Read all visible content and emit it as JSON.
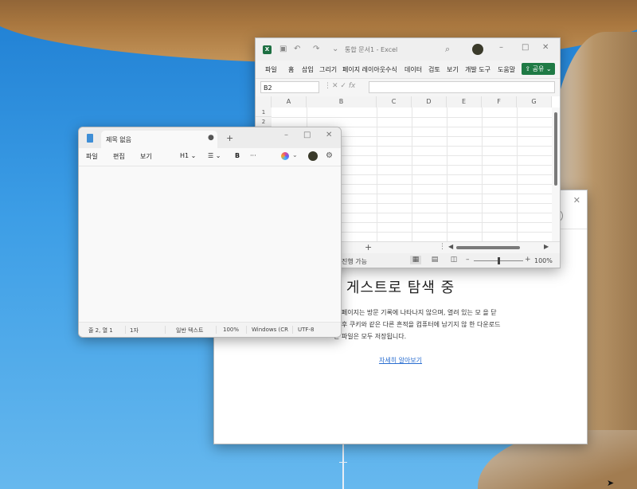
{
  "browser": {
    "title": "게스트로 탐색 중",
    "description": "는 페이지는 방문 기록에 나타나지 않으며, 열려 있는 모 을 닫은 후 쿠키와 같은 다른 흔적을 컴퓨터에 남기지 않 한 다운로드한 파일은 모두 저장됩니다.",
    "link": "자세히 알아보기",
    "close_icon": "close-icon"
  },
  "excel": {
    "doc_title": "통합 문서1 - Excel",
    "logo": "X",
    "tabs": [
      "파일",
      "홈",
      "삽입",
      "그리기",
      "페이지 레이아웃",
      "수식",
      "데이터",
      "검토",
      "보기",
      "개발 도구",
      "도움말"
    ],
    "share_label": "공유",
    "namebox": "B2",
    "fx": "fx",
    "columns": [
      "A",
      "B",
      "C",
      "D",
      "E",
      "F",
      "G"
    ],
    "rows": [
      "1",
      "2"
    ],
    "add_sheet": "+",
    "status_ready": "진행 가능",
    "zoom": "100%"
  },
  "notepad": {
    "tab_title": "제목 없음",
    "dot": "●",
    "new_tab": "+",
    "menus": [
      "파일",
      "편집",
      "보기"
    ],
    "heading": "H1",
    "bold": "B",
    "more": "···",
    "status": {
      "position": "줄 2, 열 1",
      "chars": "1자",
      "format": "일반 텍스트",
      "zoom": "100%",
      "eol": "Windows (CR",
      "encoding": "UTF-8"
    }
  },
  "colors": {
    "excel_green": "#1f7a45",
    "link_blue": "#2a6ed0",
    "sky": "#3d9ee6"
  }
}
